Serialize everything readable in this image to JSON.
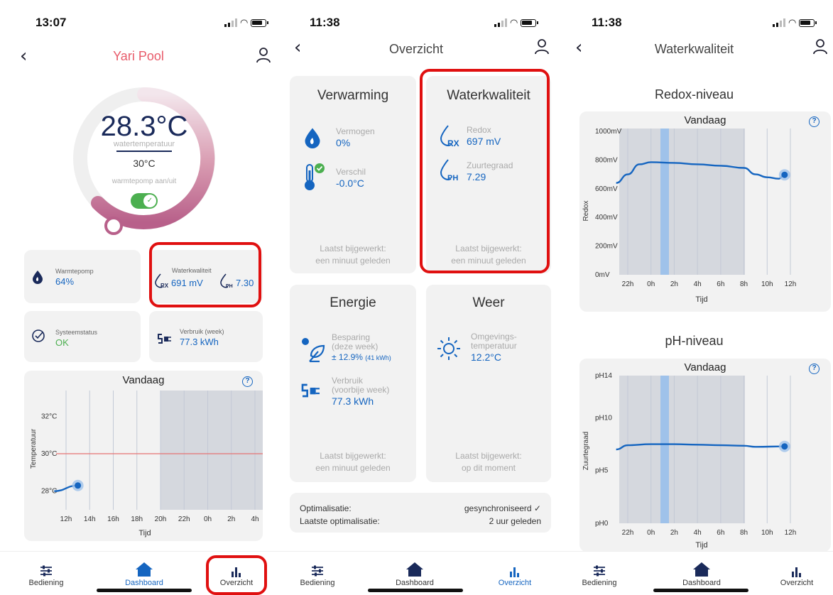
{
  "screen1": {
    "time": "13:07",
    "title": "Yari Pool",
    "temperature": "28.3°C",
    "temp_label": "watertemperatuur",
    "setpoint": "30°C",
    "pump_label": "warmtepomp aan/uit",
    "pump_on": true,
    "warmtepomp": {
      "label": "Warmtepomp",
      "value": "64%"
    },
    "waterkwaliteit": {
      "label": "Waterkwaliteit",
      "rx_icon": "RX",
      "rx_value": "691 mV",
      "ph_icon": "PH",
      "ph_value": "7.30"
    },
    "systeem": {
      "label": "Systeemstatus",
      "value": "OK"
    },
    "verbruik": {
      "label": "Verbruik (week)",
      "value": "77.3 kWh"
    },
    "chart_title": "Vandaag",
    "help": "?"
  },
  "screen2": {
    "time": "11:38",
    "title": "Overzicht",
    "verwarming": {
      "title": "Verwarming",
      "vermogen_label": "Vermogen",
      "vermogen_value": "0%",
      "verschil_label": "Verschil",
      "verschil_value": "-0.0°C",
      "updated_1": "Laatst bijgewerkt:",
      "updated_2": "een minuut geleden"
    },
    "waterkwaliteit": {
      "title": "Waterkwaliteit",
      "redox_label": "Redox",
      "redox_value": "697 mV",
      "rx_icon": "RX",
      "zuur_label": "Zuurtegraad",
      "zuur_value": "7.29",
      "ph_icon": "PH",
      "updated_1": "Laatst bijgewerkt:",
      "updated_2": "een minuut geleden"
    },
    "energie": {
      "title": "Energie",
      "besparing_1": "Besparing",
      "besparing_2": "(deze week)",
      "besparing_value": "± 12.9%",
      "besparing_kwh": "(41 kWh)",
      "verbruik_1": "Verbruik",
      "verbruik_2": "(voorbije week)",
      "verbruik_value": "77.3 kWh",
      "updated_1": "Laatst bijgewerkt:",
      "updated_2": "een minuut geleden"
    },
    "weer": {
      "title": "Weer",
      "omg_1": "Omgevings-",
      "omg_2": "temperatuur",
      "omg_value": "12.2°C",
      "updated_1": "Laatst bijgewerkt:",
      "updated_2": "op dit moment"
    },
    "optimalisatie": {
      "label_1": "Optimalisatie:",
      "value_1": "gesynchroniseerd ✓",
      "label_2": "Laatste optimalisatie:",
      "value_2": "2 uur geleden"
    }
  },
  "screen3": {
    "time": "11:38",
    "title": "Waterkwaliteit",
    "redox_heading": "Redox-niveau",
    "ph_heading": "pH-niveau",
    "chart_title": "Vandaag",
    "help": "?"
  },
  "tabs": {
    "bediening": "Bediening",
    "dashboard": "Dashboard",
    "overzicht": "Overzicht"
  },
  "chart_data": [
    {
      "type": "line",
      "title": "Vandaag",
      "xlabel": "Tijd",
      "ylabel": "Temperatuur",
      "x_ticks": [
        "12h",
        "14h",
        "16h",
        "18h",
        "20h",
        "22h",
        "0h",
        "2h",
        "4h"
      ],
      "y_ticks": [
        "28°C",
        "30°C",
        "32°C"
      ],
      "reference_line": 30,
      "series": [
        {
          "x": [
            "11h",
            "13h"
          ],
          "values": [
            28.0,
            28.3
          ]
        }
      ]
    },
    {
      "type": "line",
      "title": "Vandaag",
      "xlabel": "Tijd",
      "ylabel": "Redox",
      "x_ticks": [
        "22h",
        "0h",
        "2h",
        "4h",
        "6h",
        "8h",
        "10h",
        "12h"
      ],
      "y_ticks": [
        "0mV",
        "200mV",
        "400mV",
        "600mV",
        "800mV",
        "1000mV"
      ],
      "ylim": [
        0,
        1000
      ],
      "series": [
        {
          "x": [
            "21h",
            "22h",
            "23h",
            "0h",
            "2h",
            "4h",
            "6h",
            "8h",
            "9h",
            "10h",
            "11h",
            "11.5h"
          ],
          "values": [
            640,
            700,
            770,
            785,
            780,
            770,
            760,
            745,
            700,
            680,
            670,
            697
          ]
        }
      ]
    },
    {
      "type": "line",
      "title": "Vandaag",
      "xlabel": "Tijd",
      "ylabel": "Zuurtegraad",
      "x_ticks": [
        "22h",
        "0h",
        "2h",
        "4h",
        "6h",
        "8h",
        "10h",
        "12h"
      ],
      "y_ticks": [
        "pH0",
        "pH5",
        "pH10",
        "pH14"
      ],
      "ylim": [
        0,
        14
      ],
      "series": [
        {
          "x": [
            "21h",
            "22h",
            "0h",
            "2h",
            "4h",
            "6h",
            "8h",
            "9h",
            "11.5h"
          ],
          "values": [
            7.0,
            7.4,
            7.5,
            7.5,
            7.45,
            7.4,
            7.35,
            7.25,
            7.29
          ]
        }
      ]
    }
  ]
}
